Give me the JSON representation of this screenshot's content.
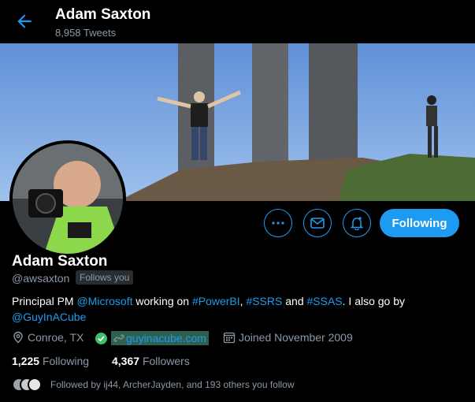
{
  "header": {
    "title": "Adam Saxton",
    "tweet_count": "8,958 Tweets"
  },
  "profile": {
    "name": "Adam Saxton",
    "handle": "@awsaxton",
    "follows_you": "Follows you",
    "bio": {
      "t1": "Principal PM ",
      "mention_ms": "@Microsoft",
      "t2": " working on ",
      "tag_pbi": "#PowerBI",
      "t3": ", ",
      "tag_ssrs": "#SSRS",
      "t4": " and ",
      "tag_ssas": "#SSAS",
      "t5": ". I also go by",
      "mention_guy": "@GuyInACube"
    },
    "location": "Conroe, TX",
    "website": "guyinacube.com",
    "joined": "Joined November 2009",
    "following_count": "1,225",
    "following_label": "Following",
    "followers_count": "4,367",
    "followers_label": "Followers",
    "followed_by": "Followed by ij44, ArcherJayden, and 193 others you follow"
  },
  "actions": {
    "following_button": "Following"
  },
  "colors": {
    "accent": "#1d9bf0",
    "background": "#000000",
    "muted": "#8b98a5"
  }
}
